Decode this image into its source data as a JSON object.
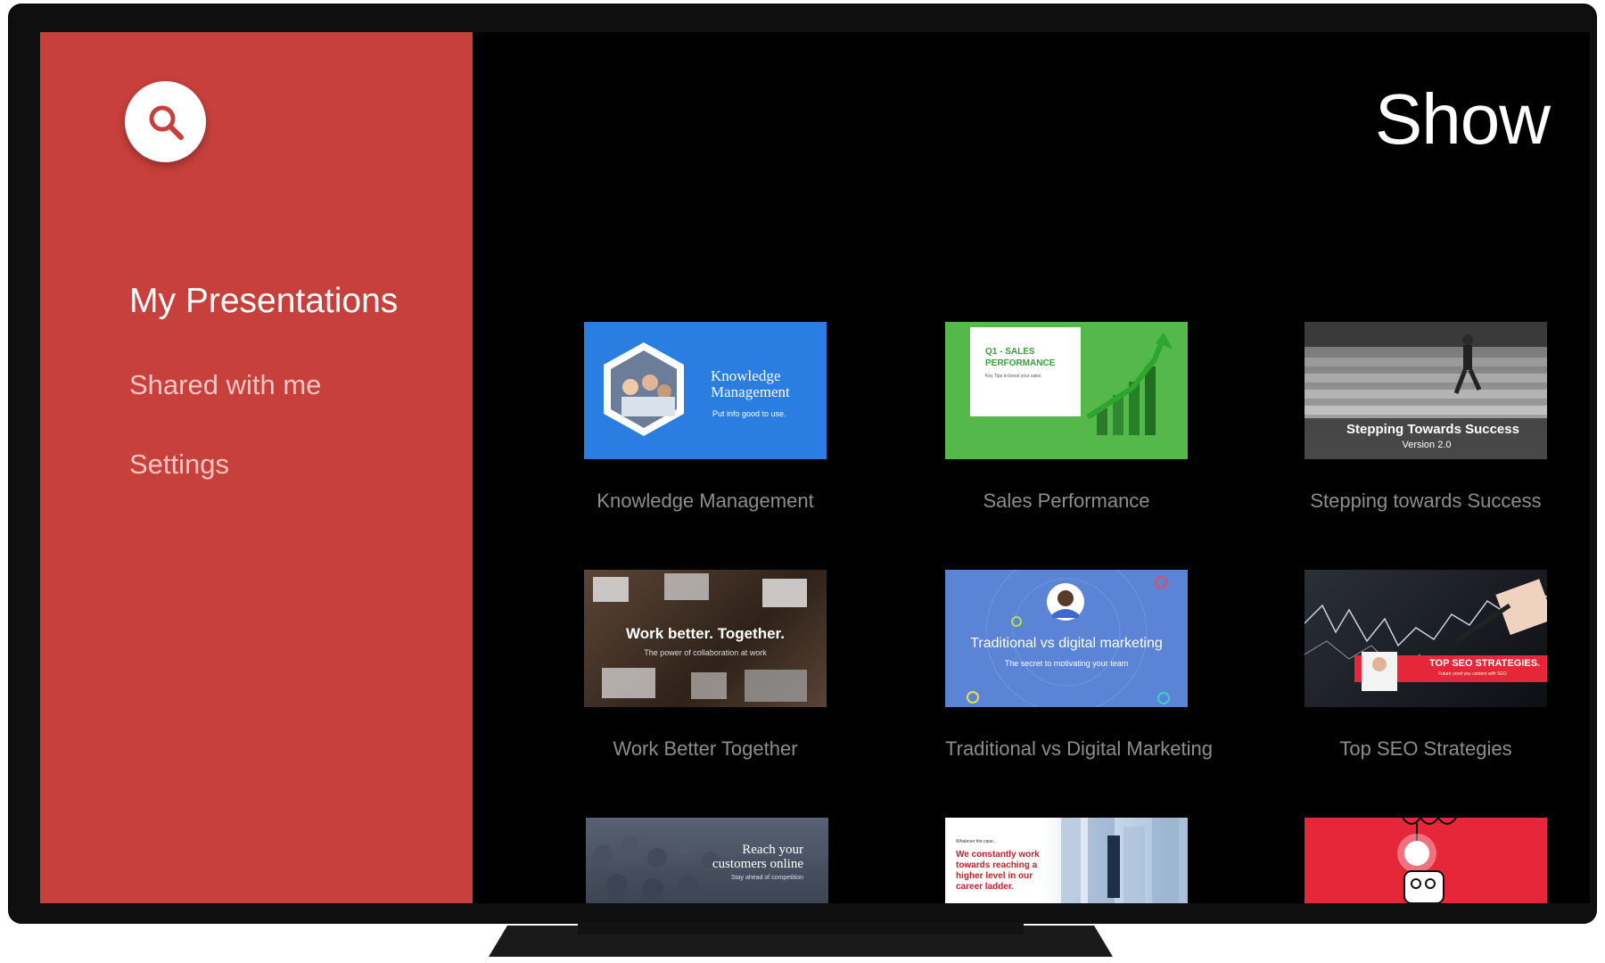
{
  "app": {
    "title": "Show",
    "accent_color": "#c8403c",
    "background_color": "#000000"
  },
  "sidebar": {
    "search_icon": "search-icon",
    "items": [
      {
        "label": "My Presentations",
        "active": true
      },
      {
        "label": "Shared with me",
        "active": false
      },
      {
        "label": "Settings",
        "active": false
      }
    ]
  },
  "presentations": [
    {
      "title": "Knowledge Management",
      "thumb_title": "Knowledge Management",
      "thumb_subtitle": "Put info good to use."
    },
    {
      "title": "Sales Performance",
      "thumb_title": "Q1 - SALES PERFORMANCE",
      "thumb_subtitle": "Key Tips to boost your sales"
    },
    {
      "title": "Stepping towards Success",
      "thumb_title": "Stepping Towards Success",
      "thumb_subtitle": "Version 2.0"
    },
    {
      "title": "Work Better Together",
      "thumb_title": "Work better. Together.",
      "thumb_subtitle": "The power of collaboration at work"
    },
    {
      "title": "Traditional vs Digital Marketing",
      "thumb_title": "Traditional vs digital marketing",
      "thumb_subtitle": "The secret to motivating your team"
    },
    {
      "title": "Top SEO Strategies",
      "thumb_title": "TOP SEO STRATEGIES.",
      "thumb_subtitle": "Future proof you content with SEO"
    },
    {
      "title": "",
      "thumb_title": "Reach your customers online",
      "thumb_subtitle": "Stay ahead of competition"
    },
    {
      "title": "",
      "thumb_title": "We constantly work towards reaching a higher level in our career ladder.",
      "thumb_kicker": "Whatever the case..."
    },
    {
      "title": "",
      "thumb_title": ""
    }
  ]
}
